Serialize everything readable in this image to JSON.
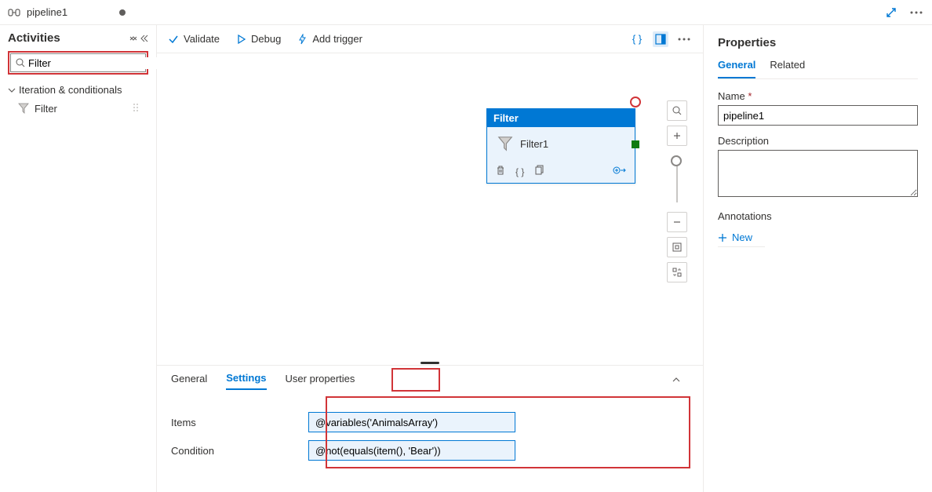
{
  "tab": {
    "name": "pipeline1"
  },
  "sidebar": {
    "title": "Activities",
    "search_value": "Filter",
    "category": "Iteration & conditionals",
    "activity": "Filter"
  },
  "toolbar": {
    "validate": "Validate",
    "debug": "Debug",
    "add_trigger": "Add trigger"
  },
  "node": {
    "type": "Filter",
    "name": "Filter1"
  },
  "settings": {
    "tabs": [
      "General",
      "Settings",
      "User properties"
    ],
    "active_index": 1,
    "fields": {
      "items_label": "Items",
      "items_value": "@variables('AnimalsArray')",
      "condition_label": "Condition",
      "condition_value": "@not(equals(item(), 'Bear'))"
    }
  },
  "properties": {
    "title": "Properties",
    "tabs": [
      "General",
      "Related"
    ],
    "name_label": "Name",
    "name_value": "pipeline1",
    "description_label": "Description",
    "annotations_label": "Annotations",
    "new_label": "New"
  }
}
